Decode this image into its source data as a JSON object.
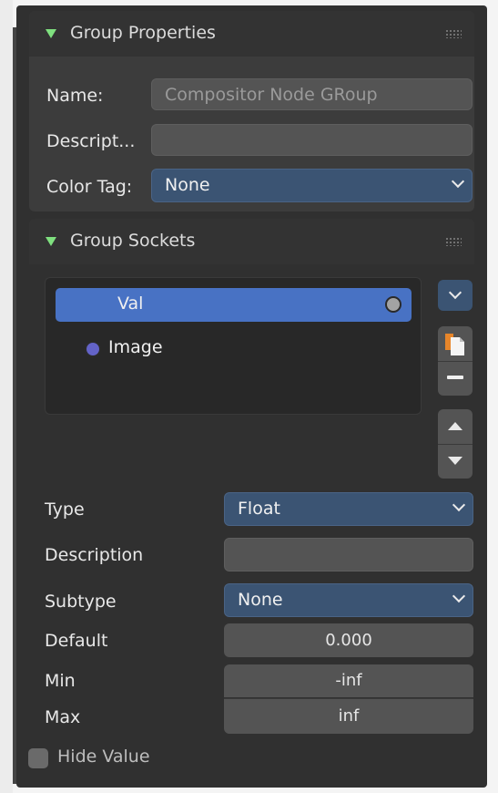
{
  "group_properties": {
    "title": "Group Properties",
    "name_label": "Name:",
    "name_value": "Compositor Node GRoup",
    "description_label": "Descript...",
    "description_value": "",
    "color_tag_label": "Color Tag:",
    "color_tag_value": "None"
  },
  "group_sockets": {
    "title": "Group Sockets",
    "sockets": [
      {
        "label": "Val",
        "selected": true
      },
      {
        "label": "Image",
        "selected": false
      }
    ]
  },
  "socket_properties": {
    "type_label": "Type",
    "type_value": "Float",
    "description_label": "Description",
    "description_value": "",
    "subtype_label": "Subtype",
    "subtype_value": "None",
    "default_label": "Default",
    "default_value": "0.000",
    "min_label": "Min",
    "min_value": "-inf",
    "max_label": "Max",
    "max_value": "inf",
    "hide_value_label": "Hide Value",
    "hide_value_checked": false
  },
  "colors": {
    "selected_row": "#4872c4",
    "dropdown": "#3b5473",
    "expand_triangle": "#7fe07f",
    "float_socket": "#a3a3a3",
    "image_socket": "#6363c7"
  },
  "icons": [
    "collapse-triangle-icon",
    "drag-grip-icon",
    "chevron-down-icon",
    "copy-icon",
    "minus-icon",
    "move-up-icon",
    "move-down-icon"
  ]
}
